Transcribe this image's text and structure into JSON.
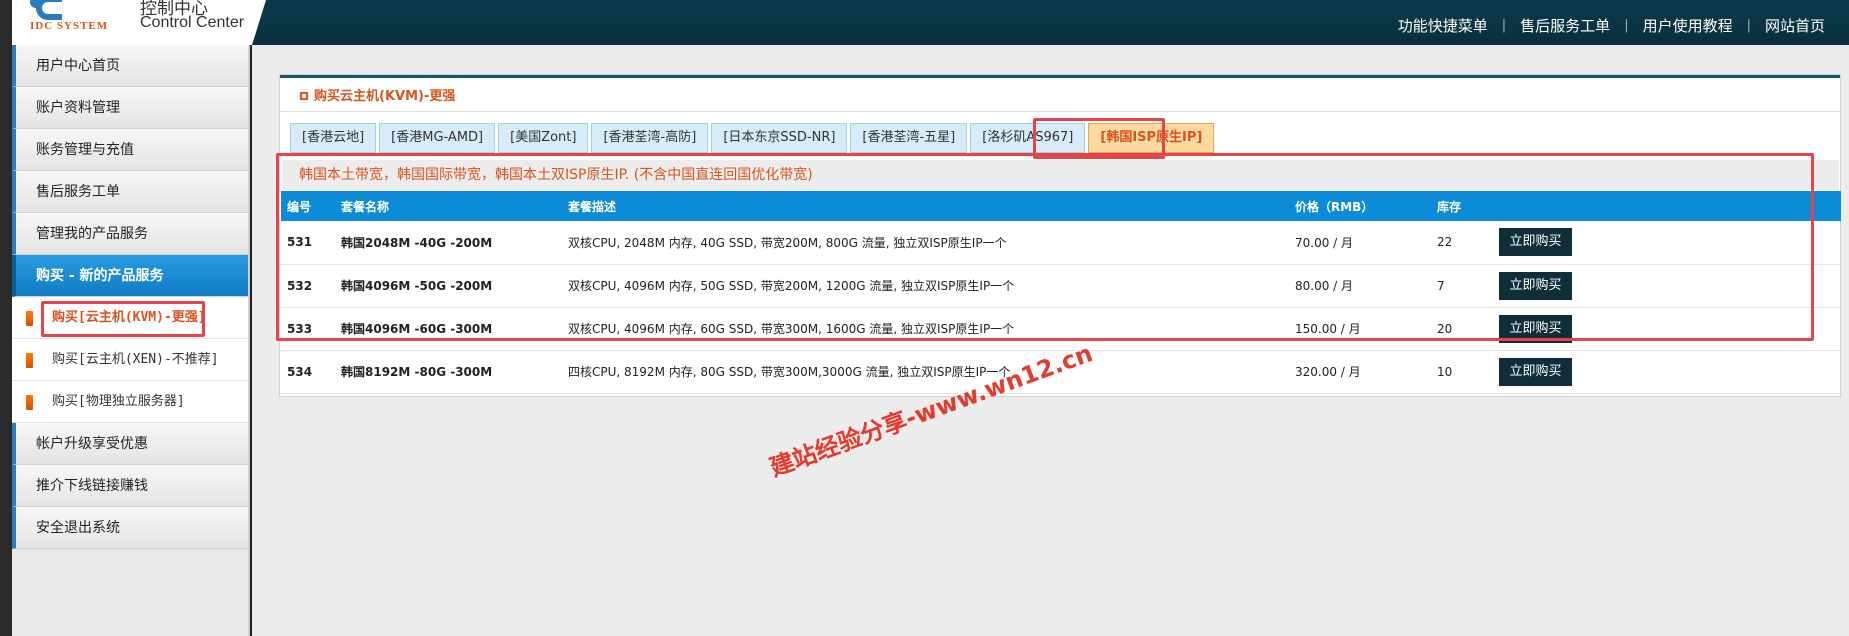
{
  "header": {
    "logo_text": "IDC SYSTEM",
    "title_cn": "控制中心",
    "title_en": "Control Center",
    "nav": [
      "功能快捷菜单",
      "售后服务工单",
      "用户使用教程",
      "网站首页"
    ]
  },
  "sidebar": {
    "items": [
      {
        "label": "用户中心首页"
      },
      {
        "label": "账户资料管理"
      },
      {
        "label": "账务管理与充值"
      },
      {
        "label": "售后服务工单"
      },
      {
        "label": "管理我的产品服务"
      },
      {
        "label": "购买 - 新的产品服务",
        "active": true
      }
    ],
    "subitems": [
      {
        "label": "购买[云主机(KVM)-更强]",
        "current": true
      },
      {
        "label": "购买[云主机(XEN)-不推荐]"
      },
      {
        "label": "购买[物理独立服务器]"
      }
    ],
    "items_after": [
      {
        "label": "帐户升级享受优惠"
      },
      {
        "label": "推介下线链接赚钱"
      },
      {
        "label": "安全退出系统"
      }
    ]
  },
  "panel": {
    "title": "购买云主机(KVM)-更强",
    "tabs": [
      "[香港云地]",
      "[香港MG-AMD]",
      "[美国Zont]",
      "[香港荃湾-高防]",
      "[日本东京SSD-NR]",
      "[香港荃湾-五星]",
      "[洛杉矶AS967]",
      "[韩国ISP原生IP]"
    ],
    "active_tab": 7,
    "notice": "韩国本土带宽，韩国国际带宽，韩国本土双ISP原生IP. (不含中国直连回国优化带宽)"
  },
  "table": {
    "headers": {
      "id": "编号",
      "name": "套餐名称",
      "desc": "套餐描述",
      "price": "价格（RMB）",
      "stock": "库存"
    },
    "rows": [
      {
        "id": "531",
        "name": "韩国2048M -40G -200M",
        "desc": "双核CPU, 2048M 内存, 40G SSD, 带宽200M, 800G 流量, 独立双ISP原生IP一个",
        "price": "70.00 / 月",
        "stock": "22",
        "button": "立即购买"
      },
      {
        "id": "532",
        "name": "韩国4096M -50G -200M",
        "desc": "双核CPU, 4096M 内存, 50G SSD, 带宽200M, 1200G 流量, 独立双ISP原生IP一个",
        "price": "80.00 / 月",
        "stock": "7",
        "button": "立即购买"
      },
      {
        "id": "533",
        "name": "韩国4096M -60G -300M",
        "desc": "双核CPU, 4096M 内存, 60G SSD, 带宽300M, 1600G 流量, 独立双ISP原生IP一个",
        "price": "150.00 / 月",
        "stock": "20",
        "button": "立即购买"
      },
      {
        "id": "534",
        "name": "韩国8192M -80G -300M",
        "desc": "四核CPU, 8192M 内存, 80G SSD, 带宽300M,3000G 流量, 独立双ISP原生IP一个",
        "price": "320.00 / 月",
        "stock": "10",
        "button": "立即购买"
      }
    ]
  },
  "watermark": "建站经验分享-www.wn12.cn",
  "colors": {
    "accent_orange": "#d9541e",
    "header_dark": "#0c3a4a",
    "table_head_blue": "#0c8bd6",
    "highlight_red": "#e8434a"
  }
}
